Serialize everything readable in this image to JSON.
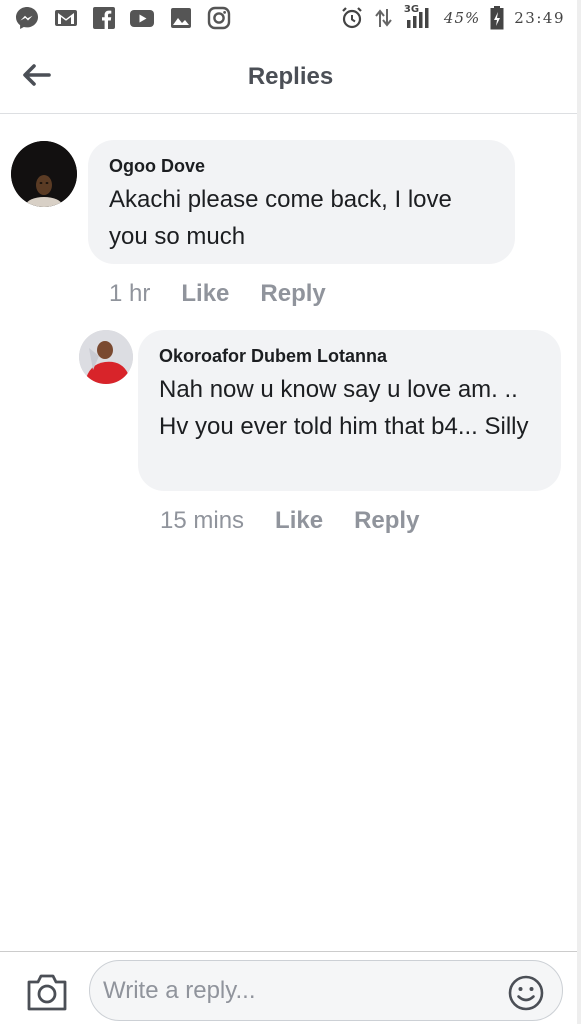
{
  "status_bar": {
    "left_icons": [
      "messenger-icon",
      "gmail-icon",
      "facebook-icon",
      "youtube-icon",
      "gallery-icon",
      "instagram-icon"
    ],
    "network": "3G",
    "battery": "45%",
    "time": "23:49"
  },
  "header": {
    "title": "Replies"
  },
  "comments": [
    {
      "author": "Ogoo Dove",
      "text": "Akachi please come back, I love you so much",
      "time": "1 hr",
      "like_label": "Like",
      "reply_label": "Reply"
    },
    {
      "author": "Okoroafor Dubem Lotanna",
      "text": "Nah now u know say u love am. .. Hv you ever told him that b4... Silly",
      "time": "15 mins",
      "like_label": "Like",
      "reply_label": "Reply"
    }
  ],
  "composer": {
    "placeholder": "Write a reply..."
  },
  "colors": {
    "bubble": "#f2f3f5",
    "meta_text": "#90949c",
    "title_text": "#4b4f56"
  }
}
